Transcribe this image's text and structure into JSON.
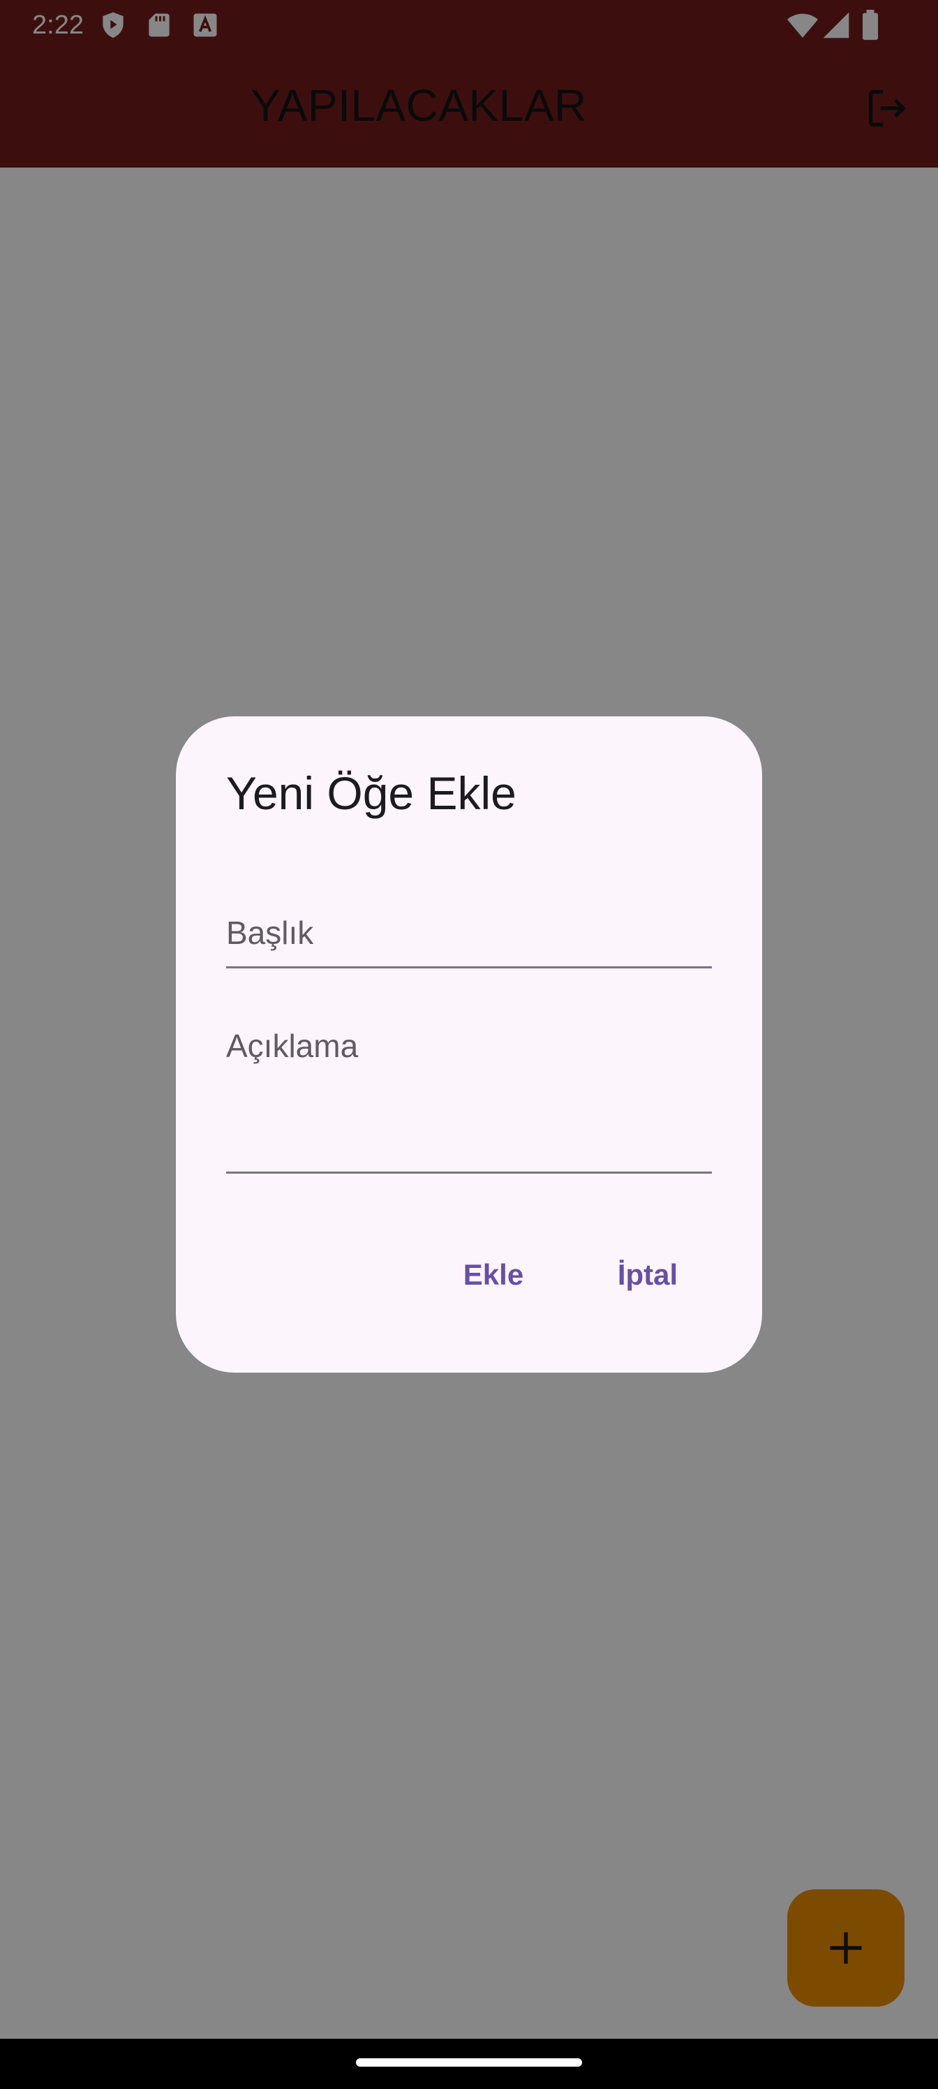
{
  "status_bar": {
    "time": "2:22",
    "left_icons": [
      "play-protect-icon",
      "sd-card-icon",
      "font-a-icon"
    ],
    "right_icons": [
      "wifi-icon",
      "signal-icon",
      "battery-icon"
    ]
  },
  "app_bar": {
    "title": "YAPILACAKLAR",
    "action_icon": "logout-icon",
    "color": "#721e1b"
  },
  "dialog": {
    "title": "Yeni Öğe Ekle",
    "fields": [
      {
        "label": "Başlık",
        "value": ""
      },
      {
        "label": "Açıklama",
        "value": ""
      }
    ],
    "buttons": {
      "add_label": "Ekle",
      "cancel_label": "İptal"
    },
    "accent_color": "#6750a4",
    "background": "#fcf5fc"
  },
  "fab": {
    "icon": "plus-icon",
    "color": "#ed8f00"
  }
}
